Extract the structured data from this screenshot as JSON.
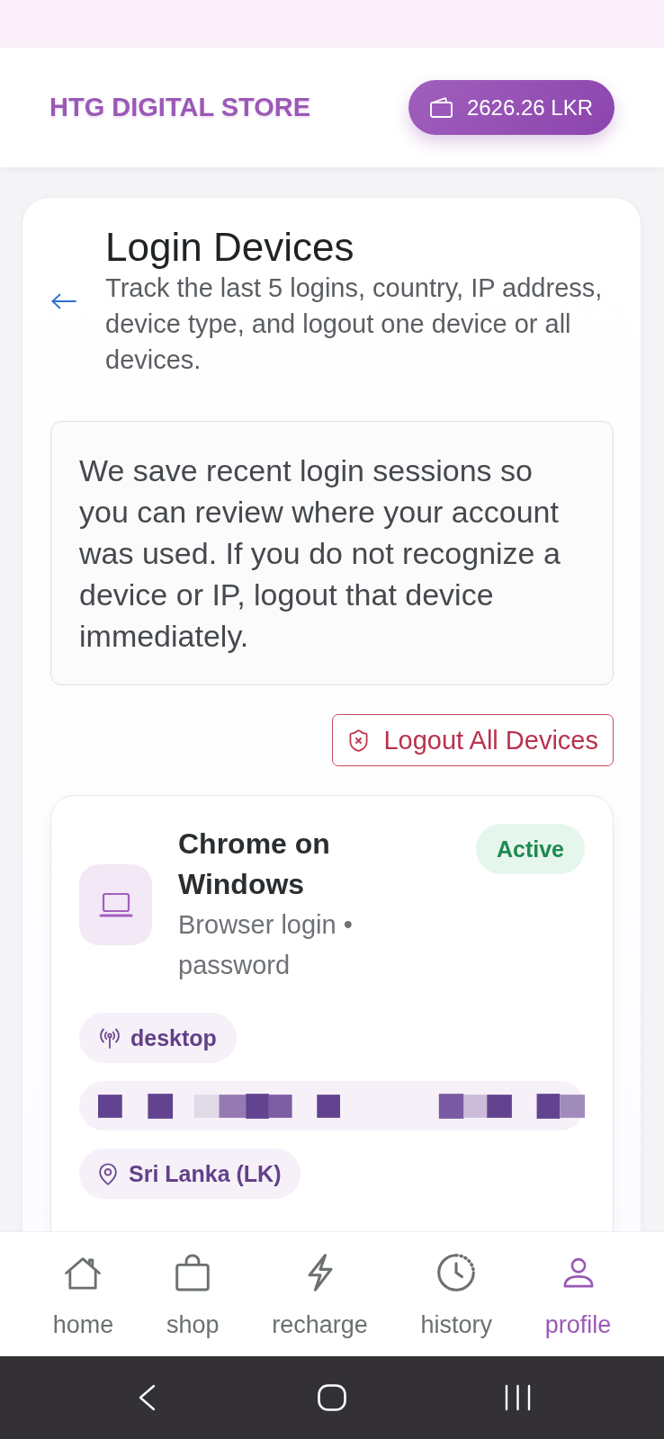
{
  "app_bar": {
    "title": "HTG DIGITAL STORE",
    "balance": "2626.26 LKR"
  },
  "page": {
    "title": "Login Devices",
    "subtitle": "Track the last 5 logins, country, IP address, device type, and logout one device or all devices."
  },
  "notice": "We save recent login sessions so you can review where your account was used. If you do not recognize a device or IP, logout that device immediately.",
  "logout_all": {
    "label": "Logout All Devices"
  },
  "devices": [
    {
      "name": "Chrome on Windows",
      "detail": "Browser login • password",
      "status": {
        "label": "Active",
        "kind": "active"
      },
      "tags": [
        {
          "kind": "device_type",
          "label": "desktop"
        },
        {
          "kind": "ip",
          "redacted": true
        },
        {
          "kind": "location",
          "label": "Sri Lanka (LK)"
        }
      ]
    }
  ],
  "bottom_nav": [
    {
      "kind": "home",
      "label": "home",
      "selected": false
    },
    {
      "kind": "shop",
      "label": "shop",
      "selected": false
    },
    {
      "kind": "recharge",
      "label": "recharge",
      "selected": false
    },
    {
      "kind": "history",
      "label": "history",
      "selected": false
    },
    {
      "kind": "profile",
      "label": "profile",
      "selected": true
    }
  ]
}
